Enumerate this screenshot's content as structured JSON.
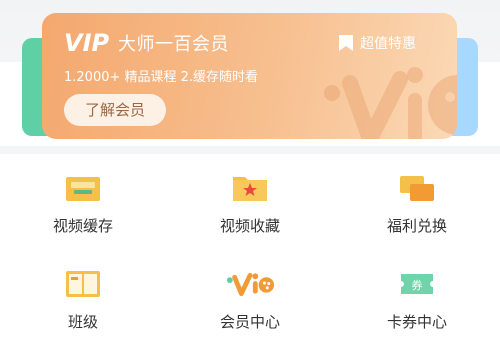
{
  "banner": {
    "logo_text": "VIP",
    "title": "大师一百会员",
    "badge_label": "超值特惠",
    "subtitle": "1.2000+ 精品课程  2.缓存随时看",
    "learn_button": "了解会员",
    "watermark_text": "vip"
  },
  "grid": {
    "items": [
      {
        "label": "视频缓存",
        "icon": "folder-download-icon"
      },
      {
        "label": "视频收藏",
        "icon": "folder-star-icon"
      },
      {
        "label": "福利兑换",
        "icon": "exchange-cards-icon"
      },
      {
        "label": "班级",
        "icon": "class-book-icon"
      },
      {
        "label": "会员中心",
        "icon": "vip-logo-icon",
        "icon_text": "vip"
      },
      {
        "label": "卡券中心",
        "icon": "coupon-ticket-icon",
        "icon_text": "券"
      }
    ]
  },
  "colors": {
    "banner_start": "#f4a86e",
    "banner_end": "#fbd9b6",
    "green_accent": "#5fd0a6",
    "blue_accent": "#a9d8ff",
    "yellow_icon": "#f5c04a",
    "orange_icon": "#f29a33",
    "red_star": "#e84b3c"
  }
}
